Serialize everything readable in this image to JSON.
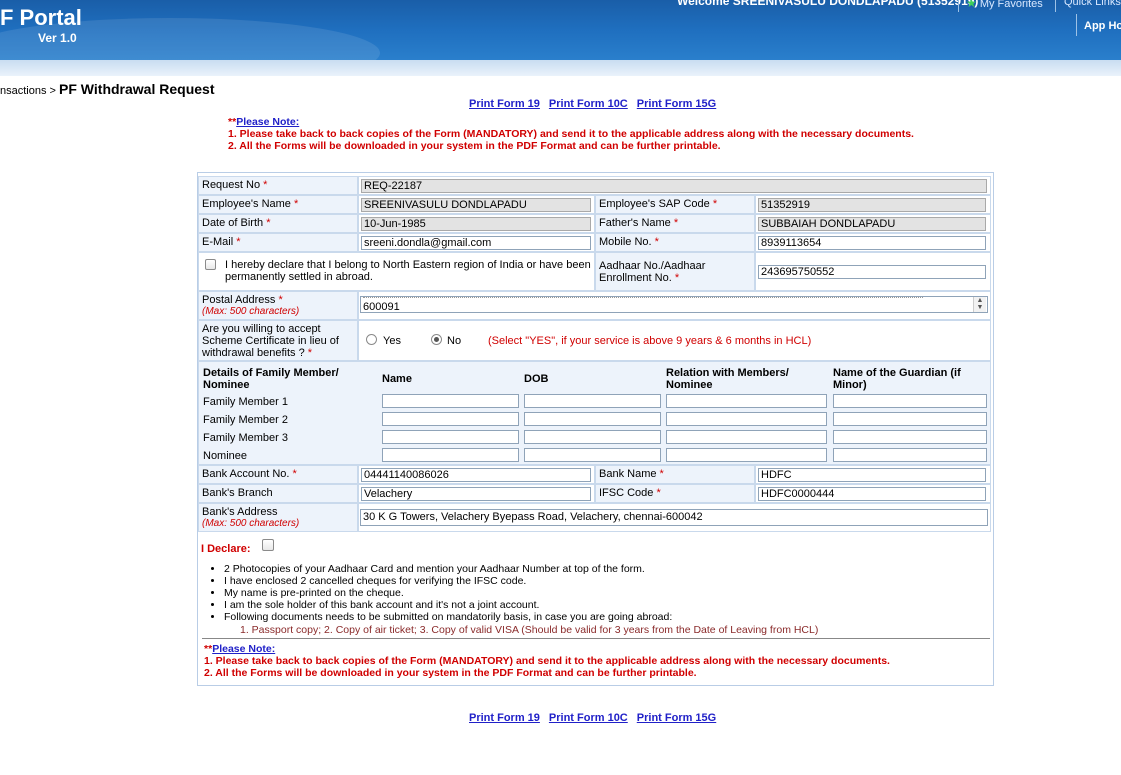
{
  "header": {
    "brand": "F Portal",
    "version": "Ver 1.0",
    "welcome": "Welcome SREENIVASULU DONDLAPADU (51352919)",
    "my_favorites": "My Favorites",
    "quick_links": "Quick Links",
    "app_home": "App Ho"
  },
  "breadcrumb": {
    "parent": "nsactions",
    "separator": " > ",
    "title": "PF Withdrawal Request"
  },
  "print_links": [
    "Print Form 19",
    "Print Form 10C",
    "Print Form 15G"
  ],
  "note": {
    "prefix": "**",
    "heading": "Please Note:",
    "line1": "1. Please take back to back copies of the Form (MANDATORY) and send it to the applicable address along with the necessary documents.",
    "line2": "2. All the Forms will be downloaded in your system in the PDF Format and can be further printable."
  },
  "form": {
    "request_no_label": "Request No",
    "request_no": "REQ-22187",
    "emp_name_label": "Employee's Name",
    "emp_name": "SREENIVASULU DONDLAPADU",
    "sap_label": "Employee's SAP Code",
    "sap_code": "51352919",
    "dob_label": "Date of Birth",
    "dob": "10-Jun-1985",
    "father_label": "Father's Name",
    "father_name": "SUBBAIAH DONDLAPADU",
    "email_label": "E-Mail",
    "email": "sreeni.dondla@gmail.com",
    "mobile_label": "Mobile No.",
    "mobile": "8939113654",
    "declare_ne_line1": "I hereby declare that I belong to North Eastern region of India or have been",
    "declare_ne_line2": "permanently settled in abroad.",
    "aadhaar_label_line1": "Aadhaar No./Aadhaar",
    "aadhaar_label_line2": "Enrollment No.",
    "aadhaar": "243695750552",
    "postal_label": "Postal Address",
    "postal_hint": "(Max: 500 characters)",
    "postal_value": "600091",
    "scheme_label_line1": "Are you willing to accept",
    "scheme_label_line2": "Scheme Certificate in lieu of",
    "scheme_label_line3": "withdrawal benefits ?",
    "yes": "Yes",
    "no": "No",
    "scheme_hint": "(Select \"YES\", if your service is above 9 years & 6 months in HCL)",
    "family_header": [
      "Details of Family Member/",
      "Nominee"
    ],
    "family_columns": [
      "Name",
      "DOB",
      "Relation with Members/",
      "Nominee",
      "Name of the Guardian (if",
      "Minor)"
    ],
    "family_rows": [
      "Family Member 1",
      "Family Member 2",
      "Family Member 3",
      "Nominee"
    ],
    "bank_acc_label": "Bank Account No.",
    "bank_acc": "04441140086026",
    "bank_name_label": "Bank Name",
    "bank_name": "HDFC",
    "branch_label": "Bank's Branch",
    "branch": "Velachery",
    "ifsc_label": "IFSC Code",
    "ifsc": "HDFC0000444",
    "bank_addr_label": "Bank's Address",
    "bank_addr_hint": "(Max: 500 characters)",
    "bank_addr": "30 K G Towers, Velachery Byepass Road, Velachery, chennai-600042",
    "i_declare": "I Declare:",
    "docs": [
      "2 Photocopies of your Aadhaar Card and mention your Aadhaar Number at top of the form.",
      "I have enclosed 2 cancelled cheques for verifying the IFSC code.",
      "My name is pre-printed on the cheque.",
      "I am the sole holder of this bank account and it's not a joint account.",
      "Following documents needs to be submitted on mandatorily basis, in case you are going abroad:"
    ],
    "docs_sub": "1. Passport copy; 2. Copy of air ticket; 3. Copy of valid VISA (Should be valid for 3 years from the Date of Leaving from HCL)",
    "asterisk": "*"
  },
  "colors": {
    "header_blue": "#1f6fbf",
    "link_blue": "#2020c8",
    "required_red": "#d00000",
    "label_bg": "#edf3fb"
  }
}
